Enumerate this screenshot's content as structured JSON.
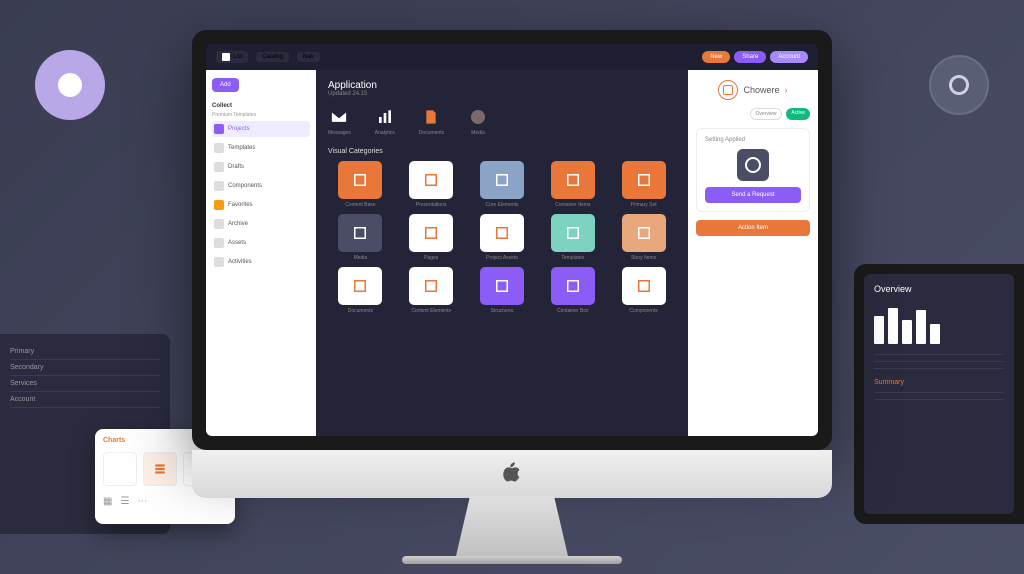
{
  "topbar": {
    "badge1": "List",
    "badge2": "Catalog",
    "badge3": "Nav",
    "btn1": "New",
    "btn2": "Share",
    "btn3": "Account"
  },
  "sidebar": {
    "btn": "Add",
    "section1": "Collect",
    "section1_sub": "Premium Templates",
    "items": [
      {
        "label": "Projects"
      },
      {
        "label": "Templates"
      },
      {
        "label": "Drafts"
      },
      {
        "label": "Components"
      },
      {
        "label": "Favorites"
      },
      {
        "label": "Archive"
      },
      {
        "label": "Assets"
      },
      {
        "label": "Activities"
      }
    ]
  },
  "main": {
    "title": "Application",
    "subtitle": "Updated 24.15",
    "tabs": [
      {
        "label": "Messages"
      },
      {
        "label": "Analytics"
      },
      {
        "label": "Documents"
      },
      {
        "label": "Media"
      }
    ],
    "section": "Visual Categories",
    "tiles_row1": [
      {
        "label": "Content Base",
        "color": "#e87739"
      },
      {
        "label": "Presentations",
        "color": "#ffffff"
      },
      {
        "label": "Core Elements",
        "color": "#8ba3c7"
      },
      {
        "label": "Container Items",
        "color": "#e87739"
      },
      {
        "label": "Primary Set",
        "color": "#e87739"
      }
    ],
    "tiles_row2": [
      {
        "label": "Media",
        "color": "#4a4d66"
      },
      {
        "label": "Pages",
        "color": "#ffffff"
      },
      {
        "label": "Project Assets",
        "color": "#ffffff"
      },
      {
        "label": "Templates",
        "color": "#7dd3c0"
      },
      {
        "label": "Story Items",
        "color": "#e8a87c"
      }
    ],
    "tiles_row3": [
      {
        "label": "Documents",
        "color": "#ffffff"
      },
      {
        "label": "Content Elements",
        "color": "#ffffff"
      },
      {
        "label": "Structures",
        "color": "#8b5cf6"
      },
      {
        "label": "Container Box",
        "color": "#8b5cf6"
      },
      {
        "label": "Components",
        "color": "#ffffff"
      }
    ]
  },
  "right": {
    "brand": "Chowere",
    "chip1": "Overview",
    "chip2": "Active",
    "card_title": "Setting Applied",
    "btn1": "Send a Request",
    "btn2": "Action Item"
  },
  "panel_left": {
    "rows": [
      "Primary",
      "Secondary",
      "Services",
      "Account"
    ]
  },
  "float": {
    "title": "Charts",
    "badge": "st"
  },
  "tablet": {
    "title": "Overview",
    "footer": "Summary"
  }
}
